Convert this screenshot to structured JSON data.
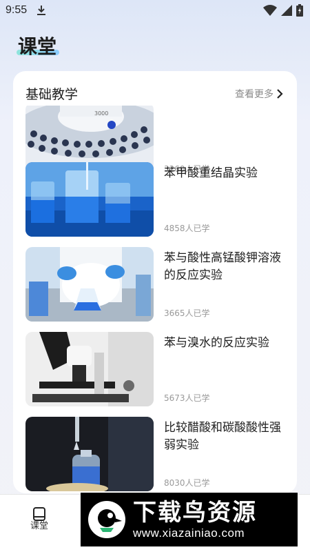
{
  "status_bar": {
    "time": "9:55"
  },
  "page": {
    "title": "课堂"
  },
  "section": {
    "title": "基础教学",
    "more_label": "查看更多"
  },
  "courses": [
    {
      "title": "",
      "learners": "3260人已学"
    },
    {
      "title": "苯甲酸重结晶实验",
      "learners": "4858人已学"
    },
    {
      "title": "苯与酸性高锰酸钾溶液的反应实验",
      "learners": "3665人已学"
    },
    {
      "title": "苯与溴水的反应实验",
      "learners": "5673人已学"
    },
    {
      "title": "比较醋酸和碳酸酸性强弱实验",
      "learners": "8030人已学"
    }
  ],
  "bottom_nav": {
    "items": [
      {
        "label": "课堂",
        "icon": "book-icon"
      }
    ]
  },
  "watermark": {
    "title": "下载鸟资源",
    "url": "www.xiazainiao.com"
  }
}
